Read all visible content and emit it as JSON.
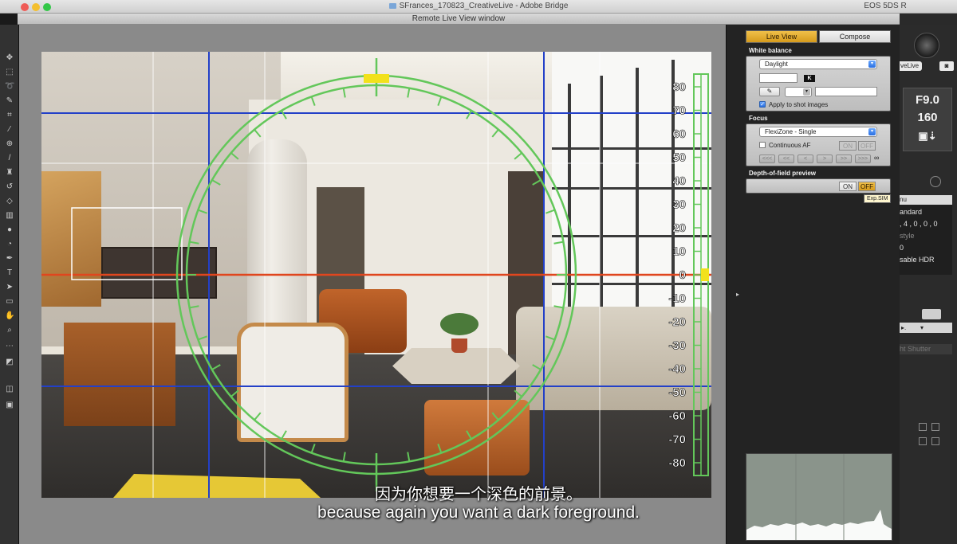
{
  "titlebar": {
    "doc_title": "SFrances_170823_CreativeLive - Adobe Bridge",
    "eos_title": "EOS 5DS R"
  },
  "window": {
    "title": "Remote Live View window"
  },
  "tabs": [
    {
      "label": "Live View",
      "active": true
    },
    {
      "label": "Compose",
      "active": false
    }
  ],
  "white_balance": {
    "section_title": "White balance",
    "preset": "Daylight",
    "kelvin_badge": "K",
    "apply_label": "Apply to shot images",
    "apply_checked": true
  },
  "focus": {
    "section_title": "Focus",
    "mode": "FlexiZone - Single",
    "continuous_af_label": "Continuous AF",
    "on_label": "ON",
    "off_label": "OFF",
    "nav_buttons": [
      "<<<",
      "<<",
      "<",
      ">",
      ">>",
      ">>>"
    ],
    "infinity_glyph": "∞"
  },
  "dof": {
    "section_title": "Depth-of-field preview",
    "on_label": "ON",
    "off_label": "OFF",
    "tooltip": "Exp.SIM"
  },
  "level_scale": {
    "labels": [
      "80",
      "70",
      "60",
      "50",
      "40",
      "30",
      "20",
      "10",
      "0",
      "-10",
      "-20",
      "-30",
      "-40",
      "-50",
      "-60",
      "-70",
      "-80"
    ]
  },
  "eos": {
    "live_label": "veLive",
    "aperture": "F9.0",
    "iso": "160",
    "menu_head": "nu",
    "rows": [
      {
        "text": "andard",
        "dim": false
      },
      {
        "text": ", 4 , 0 , 0 , 0",
        "dim": false
      },
      {
        "text": "style",
        "dim": true
      },
      {
        "text": "0",
        "dim": false
      },
      {
        "text": "sable HDR",
        "dim": false
      }
    ],
    "shutter_label": "ht Shutter"
  },
  "subtitles": {
    "zh": "因为你想要一个深色的前景。",
    "en": "because again you want a dark foreground."
  },
  "colors": {
    "accent_tab": "#e0a82a",
    "level_green": "#63c75a",
    "horizon_red": "#e0461e",
    "grid_blue": "#2340c8",
    "level_marker_yellow": "#f2e11c"
  }
}
